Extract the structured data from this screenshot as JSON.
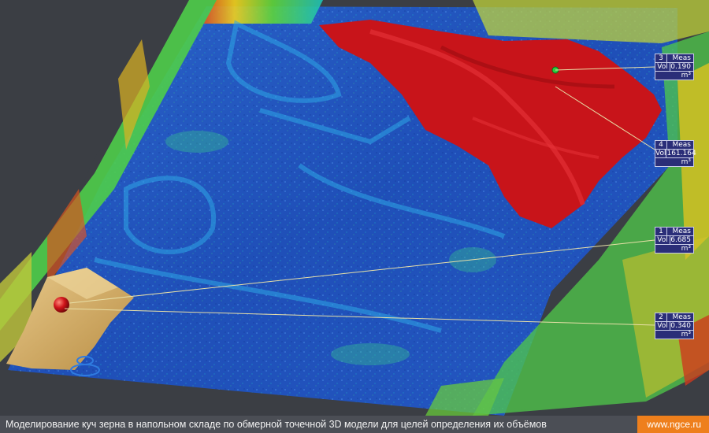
{
  "caption": "Моделирование куч зерна в напольном складе по обмерной точечной 3D модели для целей определения их объёмов",
  "site": "www.ngce.ru",
  "colors": {
    "background": "#3b3e44",
    "pile_red": "#c8141a",
    "pile_tan": "#d9b36a",
    "label_bg": "#2a2e78",
    "site_orange": "#ee7f1c"
  },
  "measurements": [
    {
      "id": "3",
      "title": "Meas",
      "key": "Vol",
      "value": "0.190",
      "unit": "m³"
    },
    {
      "id": "4",
      "title": "Meas",
      "key": "Vol",
      "value": "161.164",
      "unit": "m³"
    },
    {
      "id": "1",
      "title": "Meas",
      "key": "Vol",
      "value": "6.685",
      "unit": "m³"
    },
    {
      "id": "2",
      "title": "Meas",
      "key": "Vol",
      "value": "0.340",
      "unit": "m³"
    }
  ]
}
